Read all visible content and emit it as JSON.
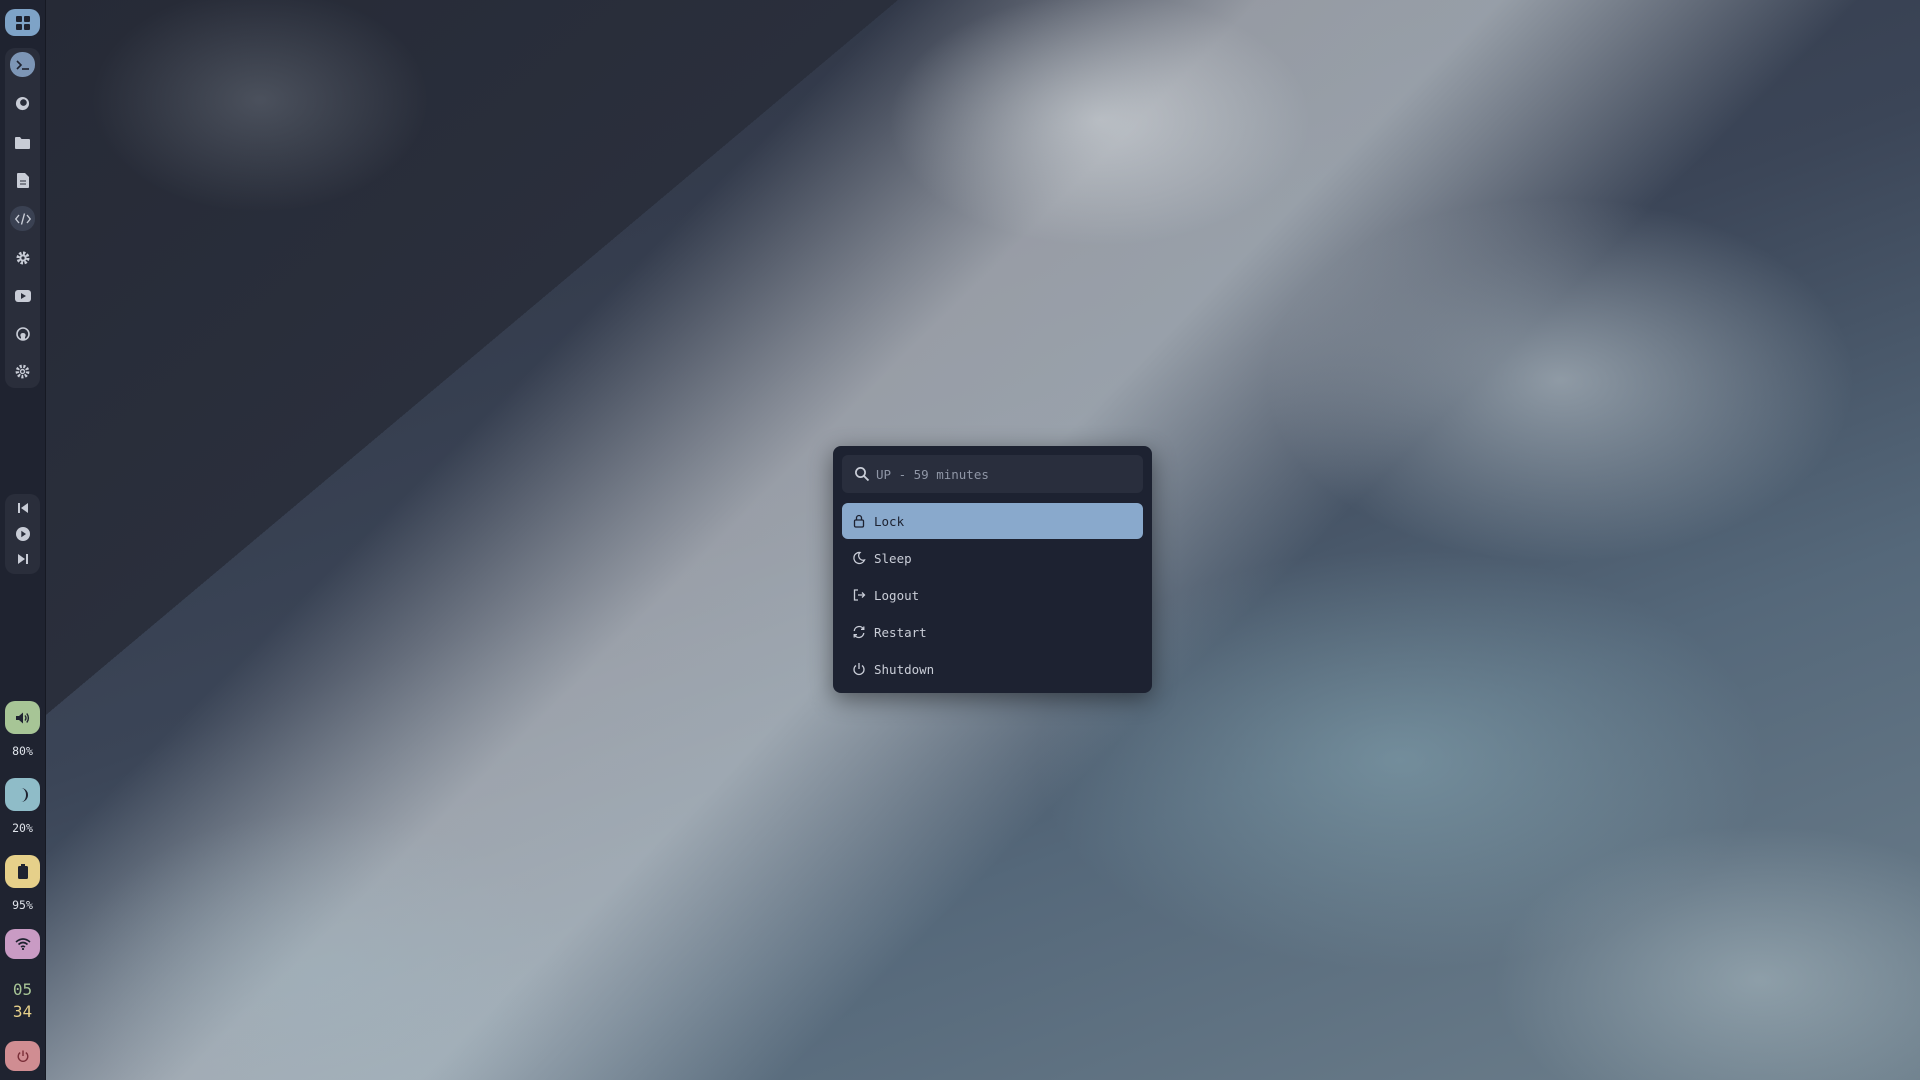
{
  "sidebar": {
    "launcher_icon": "grid-icon",
    "apps": [
      {
        "icon": "terminal-icon",
        "active": true
      },
      {
        "icon": "firefox-icon"
      },
      {
        "icon": "folder-icon"
      },
      {
        "icon": "document-icon"
      },
      {
        "icon": "code-icon"
      },
      {
        "icon": "gear-icon"
      },
      {
        "icon": "youtube-icon"
      },
      {
        "icon": "github-icon"
      },
      {
        "icon": "settings-cog-icon"
      }
    ],
    "media": [
      "previous-icon",
      "play-icon",
      "next-icon"
    ],
    "volume": {
      "label": "80%",
      "color": "#a7c596"
    },
    "brightness": {
      "label": "20%",
      "color": "#8fbcc8"
    },
    "battery": {
      "label": "95%",
      "color": "#e6d08a"
    },
    "wifi": {
      "color": "#c99bc4"
    },
    "clock": {
      "hours": "05",
      "minutes": "34"
    },
    "power_color": "#d08d92"
  },
  "power_menu": {
    "search_placeholder": "UP - 59 minutes",
    "items": [
      {
        "label": "Lock",
        "icon": "lock-icon",
        "selected": true
      },
      {
        "label": "Sleep",
        "icon": "moon-icon"
      },
      {
        "label": "Logout",
        "icon": "logout-icon"
      },
      {
        "label": "Restart",
        "icon": "restart-icon"
      },
      {
        "label": "Shutdown",
        "icon": "power-icon"
      }
    ]
  },
  "colors": {
    "accent": "#89a9cc",
    "panel": "#1d2231",
    "sidebar": "#1f2330"
  }
}
